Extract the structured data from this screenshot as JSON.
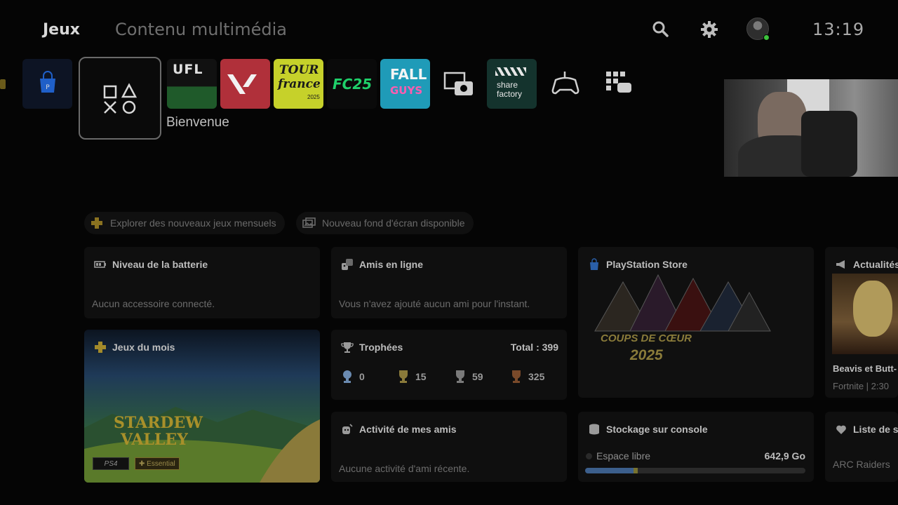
{
  "nav": {
    "active_tab": "Jeux",
    "inactive_tab": "Contenu multimédia",
    "icons": [
      "search-icon",
      "gear-icon"
    ],
    "clock": "13:19"
  },
  "game_row": {
    "selected_label": "Bienvenue",
    "tiles": [
      "playstation-store",
      "playstation-home",
      "UFL",
      "VALORANT",
      "Tour de France 2025",
      "FC25",
      "Fall Guys",
      "capture-gallery",
      "share factory",
      "remote-play",
      "game-library"
    ],
    "text": {
      "ufl": "UFL",
      "tdf_line1": "TOUR",
      "tdf_line2": "france",
      "tdf_year": "2025",
      "fc": "FC25",
      "fall1": "FALL",
      "fall2": "GUYS",
      "share1": "share",
      "share2": "factory"
    }
  },
  "chips": [
    {
      "label": "Explorer des nouveaux jeux mensuels",
      "icon": "ps-plus-icon"
    },
    {
      "label": "Nouveau fond d'écran disponible",
      "icon": "wallpaper-icon"
    }
  ],
  "cards": {
    "battery": {
      "title": "Niveau de la batterie",
      "sub": "Aucun accessoire connecté."
    },
    "friends_online": {
      "title": "Amis en ligne",
      "sub": "Vous n'avez ajouté aucun ami pour l'instant."
    },
    "store": {
      "title": "PlayStation Store",
      "banner_line1": "COUPS DE CŒUR",
      "banner_line2": "2025"
    },
    "news": {
      "title": "Actualités",
      "item_title": "Beavis et Butt-",
      "item_sub": "Fortnite | 2:30"
    },
    "monthly_games": {
      "title": "Jeux du mois",
      "game": "STARDEW",
      "game2": "VALLEY",
      "platform": "PS4",
      "tier": "Essential"
    },
    "trophies": {
      "title": "Trophées",
      "total": "Total : 399",
      "counts": {
        "platinum": "0",
        "gold": "15",
        "silver": "59",
        "bronze": "325"
      }
    },
    "friends_activity": {
      "title": "Activité de mes amis",
      "sub": "Aucune activité d'ami récente."
    },
    "storage": {
      "title": "Stockage sur console",
      "label": "Espace libre",
      "value": "642,9 Go",
      "used_fraction": 0.24
    },
    "wishlist": {
      "title": "Liste de sc",
      "item": "ARC Raiders"
    }
  },
  "colors": {
    "background": "#050505",
    "card": "#0f0f0f",
    "ps_plus": "#c9a227",
    "online": "#3cc23c",
    "storage_fill": "#3c5f8c"
  }
}
